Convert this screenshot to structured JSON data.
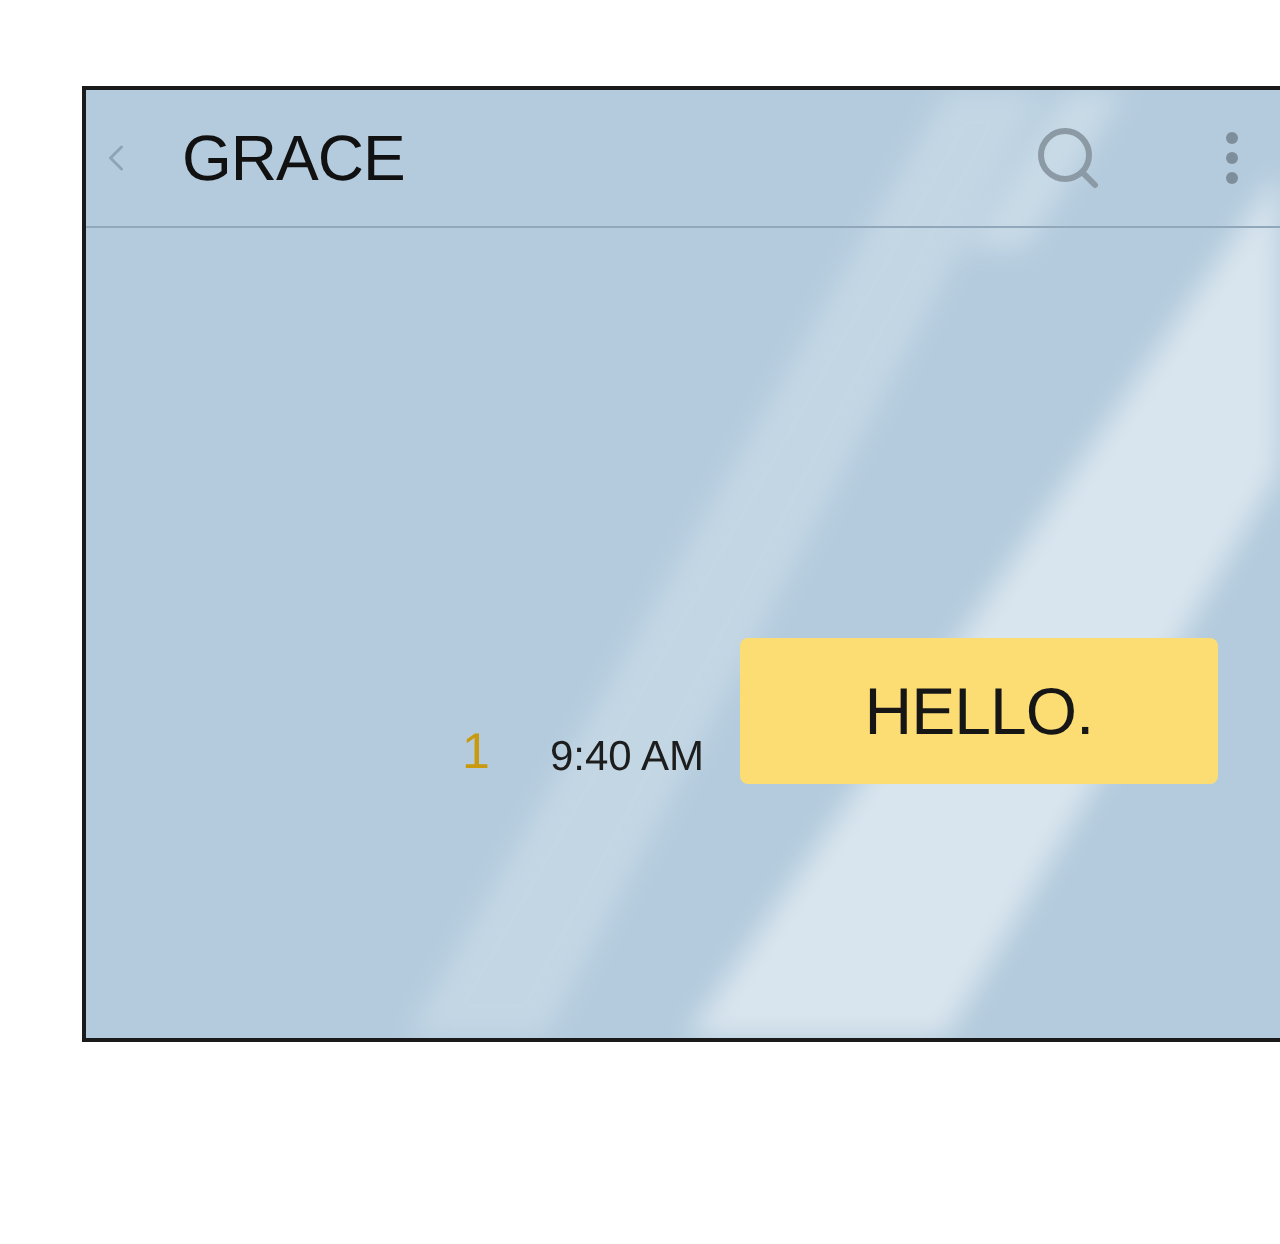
{
  "header": {
    "title": "GRACE"
  },
  "messages": [
    {
      "unread_count": "1",
      "time": "9:40 AM",
      "text": "HELLO."
    }
  ]
}
